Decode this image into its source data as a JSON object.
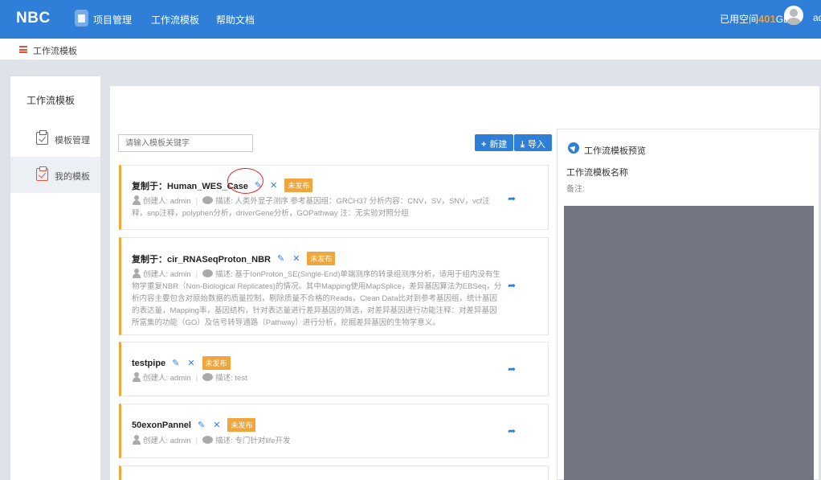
{
  "header": {
    "logo": "NBC",
    "nav": [
      "项目管理",
      "工作流模板",
      "帮助文档"
    ],
    "storage_prefix": "已用空间",
    "storage_value": "401",
    "storage_unit": "GB",
    "username": "ad"
  },
  "breadcrumb": {
    "label": "工作流模板"
  },
  "sidebar": {
    "title": "工作流模板",
    "items": [
      {
        "label": "模板管理",
        "active": false
      },
      {
        "label": "我的模板",
        "active": true
      }
    ]
  },
  "toolbar": {
    "search_placeholder": "请输入模板关键字",
    "new_label": "新建",
    "import_label": "导入"
  },
  "cards": [
    {
      "title": "复制于：Human_WES_Case",
      "status": "未发布",
      "creator": "创建人: admin",
      "desc": "描述: 人类外显子测序 参考基因组：GRCH37 分析内容：CNV，SV，SNV，vcf注释，snp注释，polyphen分析，driverGene分析，GOPathway 注：无实验对照分组"
    },
    {
      "title": "复制于：cir_RNASeqProton_NBR",
      "status": "未发布",
      "creator": "创建人: admin",
      "desc": "描述: 基于IonProton_SE(Single-End)单端测序的转录组测序分析，适用于组内没有生物学重复NBR（Non-Biological Replicates)的情况。其中Mapping使用MapSplice，差异基因算法为EBSeq，分析内容主要包含对原始数据的质量控制，剔除质量不合格的Reads，Clean Data比对到参考基因组，统计基因的表达量，Mapping率，基因结构，针对表达量进行差异基因的筛选，对差异基因进行功能注释：对差异基因所富集的功能（GO）及信号转导通路（Pathway）进行分析，挖掘差异基因的生物学意义。"
    },
    {
      "title": "testpipe",
      "status": "未发布",
      "creator": "创建人: admin",
      "desc": "描述: test"
    },
    {
      "title": "50exonPannel",
      "status": "未发布",
      "creator": "创建人: admin",
      "desc": "描述: 专门针对life开发"
    }
  ],
  "preview": {
    "title": "工作流模板预览",
    "name_label": "工作流模板名称",
    "note_label": "备注:"
  },
  "colors": {
    "primary": "#2f7fd8",
    "badge": "#f0a63c",
    "storage_num": "#ff9b1a",
    "highlight_circle": "#e8201b"
  }
}
